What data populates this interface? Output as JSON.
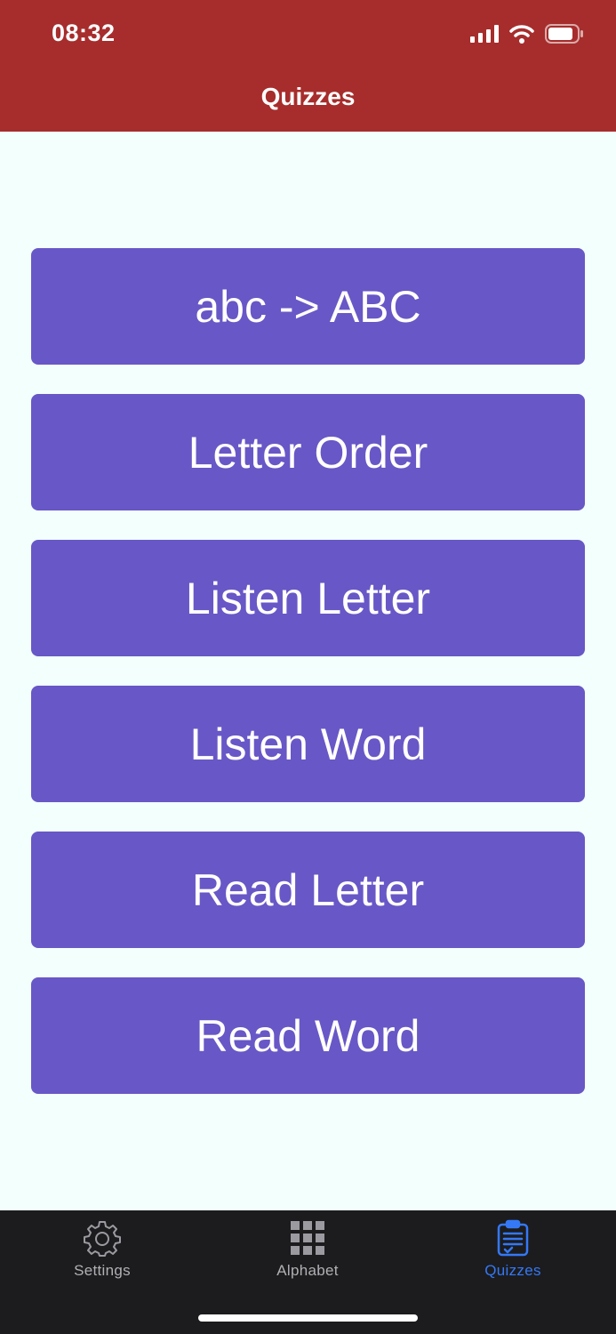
{
  "status_bar": {
    "time": "08:32",
    "icons": [
      "cellular-signal-icon",
      "wifi-icon",
      "battery-icon"
    ]
  },
  "header": {
    "title": "Quizzes",
    "background_color": "#a62d2c"
  },
  "quizzes": [
    {
      "label": "abc -> ABC"
    },
    {
      "label": "Letter Order"
    },
    {
      "label": "Listen Letter"
    },
    {
      "label": "Listen Word"
    },
    {
      "label": "Read Letter"
    },
    {
      "label": "Read Word"
    }
  ],
  "quiz_button_color": "#6857c6",
  "tab_bar": {
    "tabs": [
      {
        "label": "Settings",
        "icon": "gear-icon",
        "active": false
      },
      {
        "label": "Alphabet",
        "icon": "grid-icon",
        "active": false
      },
      {
        "label": "Quizzes",
        "icon": "clipboard-icon",
        "active": true
      }
    ],
    "active_color": "#3478f6",
    "inactive_color": "#b0b0b5"
  }
}
